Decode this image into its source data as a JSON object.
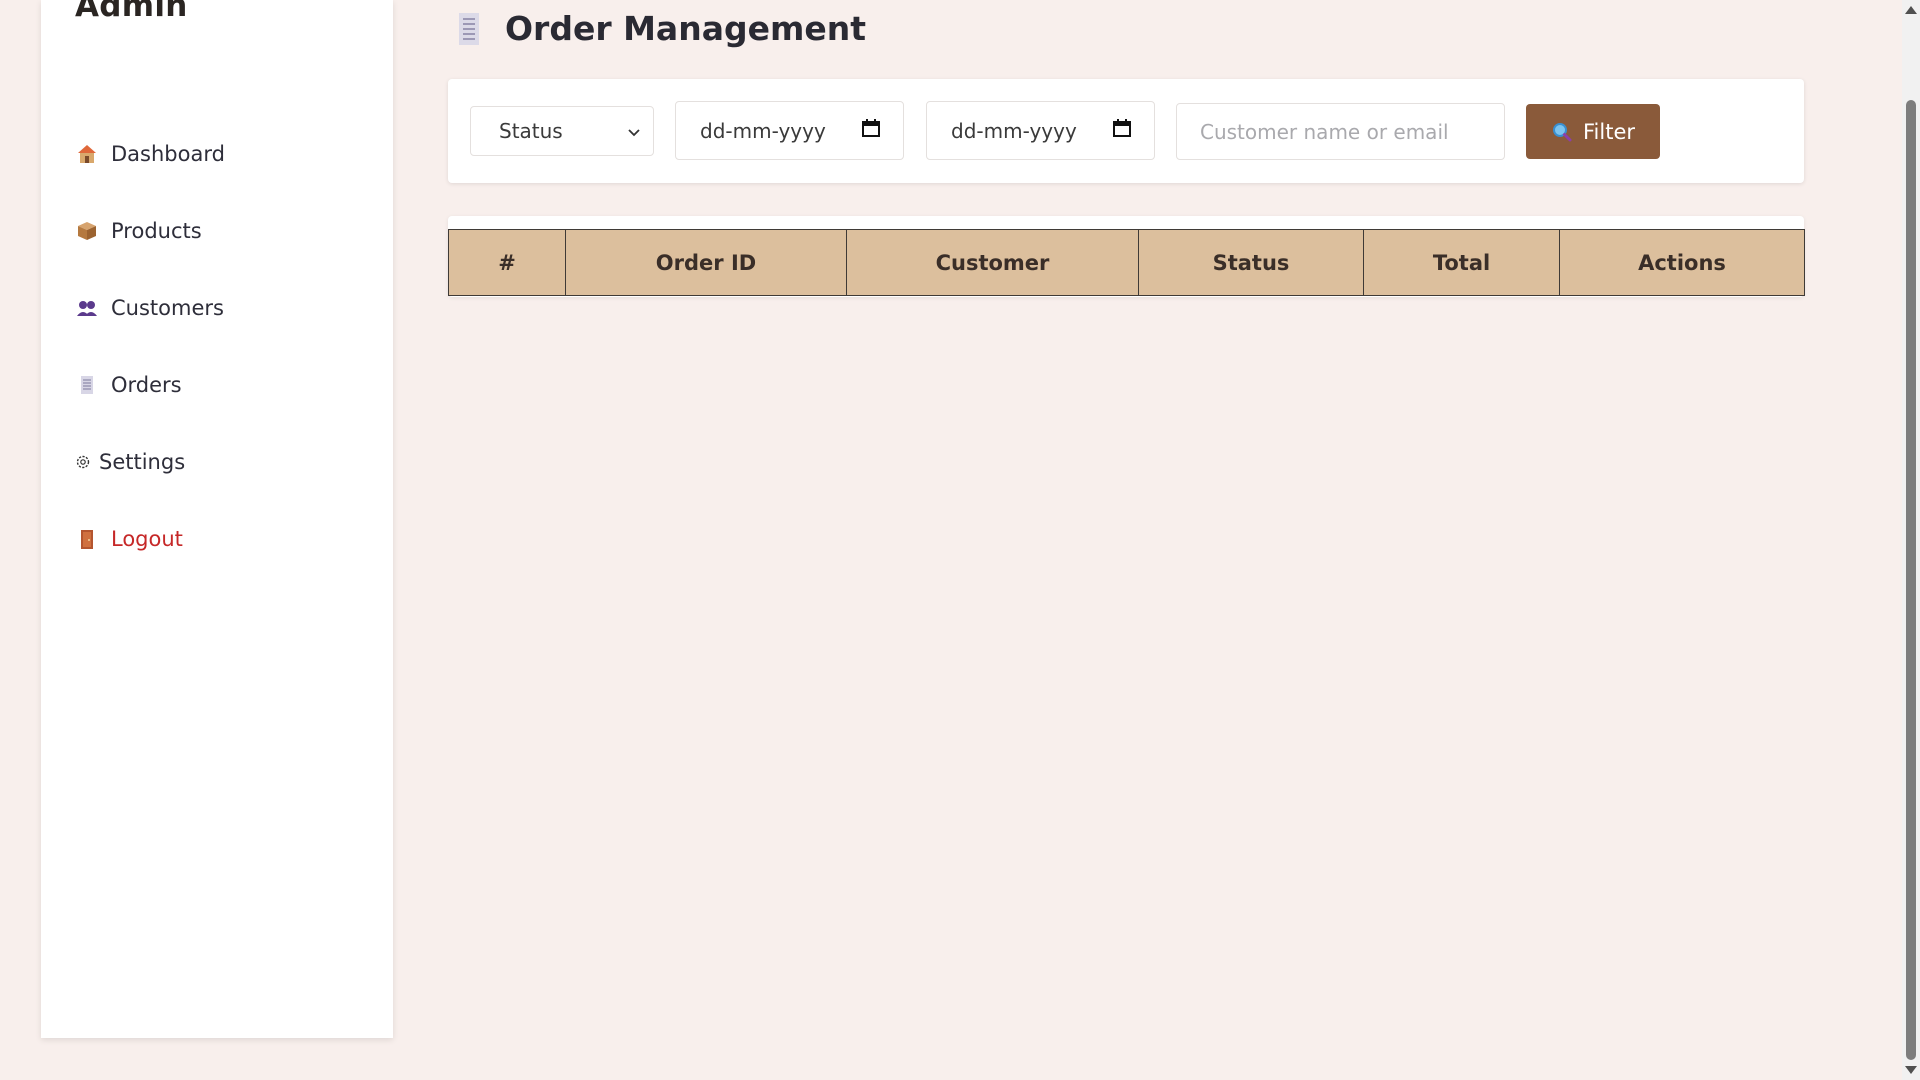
{
  "sidebar": {
    "brand": "Admin",
    "items": [
      {
        "label": "Dashboard",
        "icon": "house-icon"
      },
      {
        "label": "Products",
        "icon": "package-icon"
      },
      {
        "label": "Customers",
        "icon": "users-icon"
      },
      {
        "label": "Orders",
        "icon": "receipt-icon"
      },
      {
        "label": "Settings",
        "icon": "gear-icon"
      },
      {
        "label": "Logout",
        "icon": "door-icon"
      }
    ]
  },
  "main": {
    "title": "Order Management",
    "title_icon": "receipt-icon",
    "filters": {
      "status_selected": "Status",
      "date_from_placeholder": "dd-mm-yyyy",
      "date_to_placeholder": "dd-mm-yyyy",
      "search_placeholder": "Customer name or email",
      "filter_button_label": "Filter",
      "filter_button_icon": "search-icon"
    },
    "table": {
      "columns": [
        "#",
        "Order ID",
        "Customer",
        "Status",
        "Total",
        "Actions"
      ],
      "rows": []
    }
  },
  "colors": {
    "page_bg": "#f8efec",
    "accent": "#8a5a3a",
    "table_header": "#dcbf9d",
    "logout": "#c62828"
  }
}
